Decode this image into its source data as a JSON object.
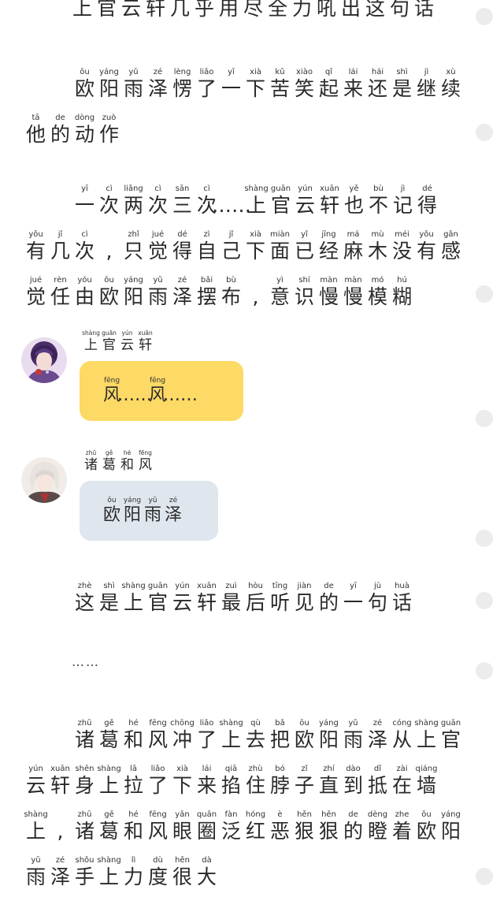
{
  "top_line": "上官云轩几乎用尽全力吼出这句话",
  "para1": {
    "lines": [
      {
        "indent": true,
        "chars": [
          [
            "ōu",
            "欧"
          ],
          [
            "yáng",
            "阳"
          ],
          [
            "yǔ",
            "雨"
          ],
          [
            "zé",
            "泽"
          ],
          [
            "lèng",
            "愣"
          ],
          [
            "liǎo",
            "了"
          ],
          [
            "yī",
            "一"
          ],
          [
            "xià",
            "下"
          ],
          [
            "kǔ",
            "苦"
          ],
          [
            "xiào",
            "笑"
          ],
          [
            "qǐ",
            "起"
          ],
          [
            "lái",
            "来"
          ],
          [
            "hái",
            "还"
          ],
          [
            "shì",
            "是"
          ],
          [
            "jì",
            "继"
          ],
          [
            "xù",
            "续"
          ]
        ]
      },
      {
        "indent": false,
        "chars": [
          [
            "tā",
            "他"
          ],
          [
            "de",
            "的"
          ],
          [
            "dòng",
            "动"
          ],
          [
            "zuò",
            "作"
          ]
        ]
      }
    ]
  },
  "para2": {
    "lines": [
      {
        "indent": true,
        "chars": [
          [
            "yī",
            "一"
          ],
          [
            "cì",
            "次"
          ],
          [
            "liǎng",
            "两"
          ],
          [
            "cì",
            "次"
          ],
          [
            "sān",
            "三"
          ],
          [
            "cì",
            "次"
          ],
          [
            "",
            "……"
          ],
          [
            "shàng",
            "上"
          ],
          [
            "guān",
            "官"
          ],
          [
            "yún",
            "云"
          ],
          [
            "xuān",
            "轩"
          ],
          [
            "yě",
            "也"
          ],
          [
            "bù",
            "不"
          ],
          [
            "jì",
            "记"
          ],
          [
            "dé",
            "得"
          ]
        ]
      },
      {
        "indent": false,
        "chars": [
          [
            "yǒu",
            "有"
          ],
          [
            "jǐ",
            "几"
          ],
          [
            "cì",
            "次"
          ],
          [
            "",
            ","
          ],
          [
            "zhǐ",
            "只"
          ],
          [
            "jué",
            "觉"
          ],
          [
            "dé",
            "得"
          ],
          [
            "zì",
            "自"
          ],
          [
            "jǐ",
            "己"
          ],
          [
            "xià",
            "下"
          ],
          [
            "miàn",
            "面"
          ],
          [
            "yǐ",
            "已"
          ],
          [
            "jīng",
            "经"
          ],
          [
            "má",
            "麻"
          ],
          [
            "mù",
            "木"
          ],
          [
            "méi",
            "没"
          ],
          [
            "yǒu",
            "有"
          ],
          [
            "gǎn",
            "感"
          ]
        ]
      },
      {
        "indent": false,
        "chars": [
          [
            "jué",
            "觉"
          ],
          [
            "rèn",
            "任"
          ],
          [
            "yóu",
            "由"
          ],
          [
            "ōu",
            "欧"
          ],
          [
            "yáng",
            "阳"
          ],
          [
            "yǔ",
            "雨"
          ],
          [
            "zé",
            "泽"
          ],
          [
            "bǎi",
            "摆"
          ],
          [
            "bù",
            "布"
          ],
          [
            "",
            ","
          ],
          [
            "yì",
            "意"
          ],
          [
            "shí",
            "识"
          ],
          [
            "màn",
            "慢"
          ],
          [
            "màn",
            "慢"
          ],
          [
            "mó",
            "模"
          ],
          [
            "hú",
            "糊"
          ]
        ]
      }
    ]
  },
  "msg1": {
    "name": [
      [
        "shàng",
        "上"
      ],
      [
        "guān",
        "官"
      ],
      [
        "yún",
        "云"
      ],
      [
        "xuān",
        "轩"
      ]
    ],
    "text": [
      [
        "fēng",
        "风"
      ],
      [
        "",
        "……"
      ],
      [
        "fēng",
        "风"
      ],
      [
        "",
        "……"
      ]
    ],
    "bubble_color": "#fdd965"
  },
  "msg2": {
    "name": [
      [
        "zhū",
        "诸"
      ],
      [
        "gě",
        "葛"
      ],
      [
        "hé",
        "和"
      ],
      [
        "fēng",
        "风"
      ]
    ],
    "text": [
      [
        "ōu",
        "欧"
      ],
      [
        "yáng",
        "阳"
      ],
      [
        "yǔ",
        "雨"
      ],
      [
        "zé",
        "泽"
      ]
    ],
    "bubble_color": "#dfe6ee"
  },
  "para3": {
    "lines": [
      {
        "indent": true,
        "chars": [
          [
            "zhè",
            "这"
          ],
          [
            "shì",
            "是"
          ],
          [
            "shàng",
            "上"
          ],
          [
            "guān",
            "官"
          ],
          [
            "yún",
            "云"
          ],
          [
            "xuān",
            "轩"
          ],
          [
            "zuì",
            "最"
          ],
          [
            "hòu",
            "后"
          ],
          [
            "tīng",
            "听"
          ],
          [
            "jiàn",
            "见"
          ],
          [
            "de",
            "的"
          ],
          [
            "yī",
            "一"
          ],
          [
            "jù",
            "句"
          ],
          [
            "huà",
            "话"
          ]
        ]
      }
    ]
  },
  "ellipsis": "……",
  "para4": {
    "lines": [
      {
        "indent": true,
        "chars": [
          [
            "zhū",
            "诸"
          ],
          [
            "gě",
            "葛"
          ],
          [
            "hé",
            "和"
          ],
          [
            "fēng",
            "风"
          ],
          [
            "chōng",
            "冲"
          ],
          [
            "liǎo",
            "了"
          ],
          [
            "shàng",
            "上"
          ],
          [
            "qù",
            "去"
          ],
          [
            "bǎ",
            "把"
          ],
          [
            "ōu",
            "欧"
          ],
          [
            "yáng",
            "阳"
          ],
          [
            "yǔ",
            "雨"
          ],
          [
            "zé",
            "泽"
          ],
          [
            "cóng",
            "从"
          ],
          [
            "shàng",
            "上"
          ],
          [
            "guān",
            "官"
          ]
        ]
      },
      {
        "indent": false,
        "chars": [
          [
            "yún",
            "云"
          ],
          [
            "xuān",
            "轩"
          ],
          [
            "shēn",
            "身"
          ],
          [
            "shàng",
            "上"
          ],
          [
            "lā",
            "拉"
          ],
          [
            "liǎo",
            "了"
          ],
          [
            "xià",
            "下"
          ],
          [
            "lái",
            "来"
          ],
          [
            "qiā",
            "掐"
          ],
          [
            "zhù",
            "住"
          ],
          [
            "bó",
            "脖"
          ],
          [
            "zǐ",
            "子"
          ],
          [
            "zhí",
            "直"
          ],
          [
            "dào",
            "到"
          ],
          [
            "dǐ",
            "抵"
          ],
          [
            "zài",
            "在"
          ],
          [
            "qiáng",
            "墙"
          ]
        ]
      },
      {
        "indent": false,
        "chars": [
          [
            "shàng",
            "上"
          ],
          [
            "",
            ","
          ],
          [
            "zhū",
            "诸"
          ],
          [
            "gě",
            "葛"
          ],
          [
            "hé",
            "和"
          ],
          [
            "fēng",
            "风"
          ],
          [
            "yǎn",
            "眼"
          ],
          [
            "quān",
            "圈"
          ],
          [
            "fàn",
            "泛"
          ],
          [
            "hóng",
            "红"
          ],
          [
            "è",
            "恶"
          ],
          [
            "hěn",
            "狠"
          ],
          [
            "hěn",
            "狠"
          ],
          [
            "de",
            "的"
          ],
          [
            "dèng",
            "瞪"
          ],
          [
            "zhe",
            "着"
          ],
          [
            "ōu",
            "欧"
          ],
          [
            "yáng",
            "阳"
          ]
        ]
      },
      {
        "indent": false,
        "chars": [
          [
            "yǔ",
            "雨"
          ],
          [
            "zé",
            "泽"
          ],
          [
            "shǒu",
            "手"
          ],
          [
            "shàng",
            "上"
          ],
          [
            "lì",
            "力"
          ],
          [
            "dù",
            "度"
          ],
          [
            "hěn",
            "很"
          ],
          [
            "dà",
            "大"
          ]
        ]
      }
    ]
  }
}
